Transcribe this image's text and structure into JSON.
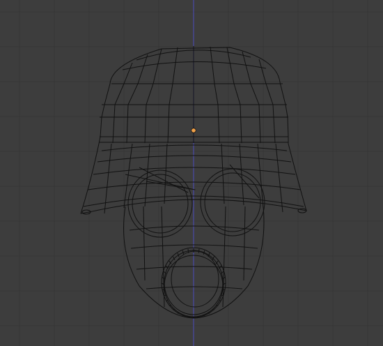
{
  "viewport": {
    "mode": "wireframe",
    "view": "front",
    "grid": true,
    "z_axis_visible": true
  },
  "object": {
    "description_icon": "helmet-gasmask-wireframe-icon",
    "origin_selected": true
  },
  "colors": {
    "background": "#3d3d3d",
    "grid_line": "#363636",
    "z_axis": "#4a4aa8",
    "wire": "#111111",
    "origin": "#f2a24a"
  }
}
